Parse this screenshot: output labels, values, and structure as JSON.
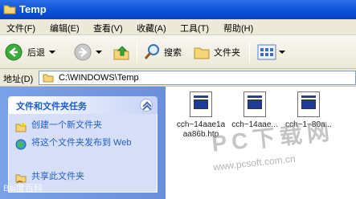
{
  "window": {
    "title": "Temp"
  },
  "menu": [
    "文件(F)",
    "编辑(E)",
    "查看(V)",
    "收藏(A)",
    "工具(T)",
    "帮助(H)"
  ],
  "toolbar": {
    "back": "后退",
    "search": "搜索",
    "folders": "文件夹"
  },
  "address": {
    "label": "地址(D)",
    "path": "C:\\WINDOWS\\Temp"
  },
  "task_panel": {
    "title": "文件和文件夹任务",
    "items": [
      {
        "icon": "new-folder-icon",
        "label": "创建一个新文件夹"
      },
      {
        "icon": "web-publish-icon",
        "label": "将这个文件夹发布到 Web"
      },
      {
        "icon": "share-folder-icon",
        "label": "共享此文件夹"
      }
    ]
  },
  "files": [
    {
      "name_line1": "cch~14aae1a",
      "name_line2": "aa86b.htp"
    },
    {
      "name_line1": "cch~14aae...",
      "name_line2": ""
    },
    {
      "name_line1": "cch~1~80a...",
      "name_line2": ""
    }
  ],
  "watermark": {
    "brand": "PC下载网",
    "url": "www.pcsoft.com.cn",
    "baidu": "Bai度百科"
  }
}
